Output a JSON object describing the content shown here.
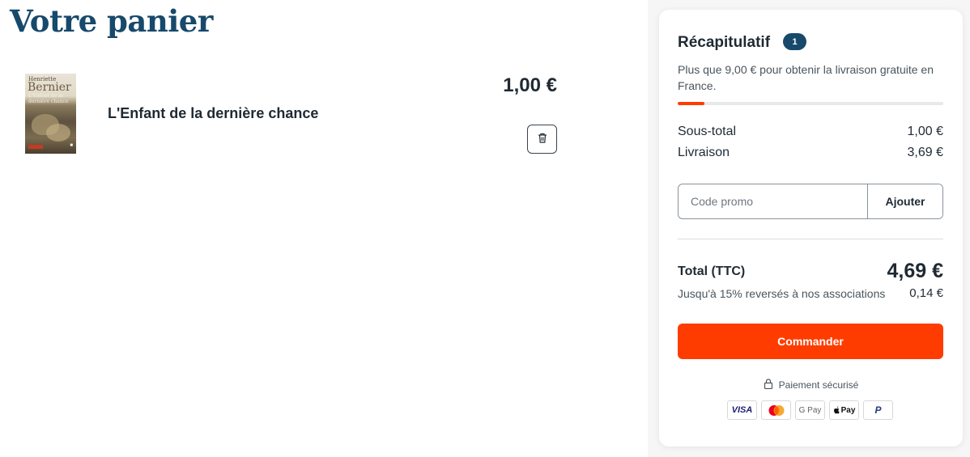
{
  "page": {
    "title": "Votre panier"
  },
  "cart": {
    "items": [
      {
        "title": "L'Enfant de la dernière chance",
        "price": "1,00 €",
        "cover": {
          "author_line1": "Henriette",
          "author_line2": "Bernier",
          "title_line": "L'Enfant de la dernière chance"
        },
        "delete_icon": "trash-icon"
      }
    ]
  },
  "summary": {
    "title": "Récapitulatif",
    "count": "1",
    "shipping_message": "Plus que 9,00 € pour obtenir la livraison gratuite en France.",
    "free_shipping_progress": 0.1,
    "subtotal_label": "Sous-total",
    "subtotal_value": "1,00 €",
    "shipping_label": "Livraison",
    "shipping_value": "3,69 €",
    "promo_placeholder": "Code promo",
    "promo_button": "Ajouter",
    "total_label": "Total (TTC)",
    "total_value": "4,69 €",
    "associations_label": "Jusqu'à 15% reversés à nos associations",
    "associations_value": "0,14 €",
    "order_button": "Commander",
    "secure_label": "Paiement sécurisé",
    "payment_methods": [
      "VISA",
      "Mastercard",
      "G Pay",
      "Apple Pay",
      "PayPal"
    ]
  },
  "colors": {
    "accent": "#ff3c00",
    "brand": "#17496b",
    "text": "#1f2a33"
  }
}
